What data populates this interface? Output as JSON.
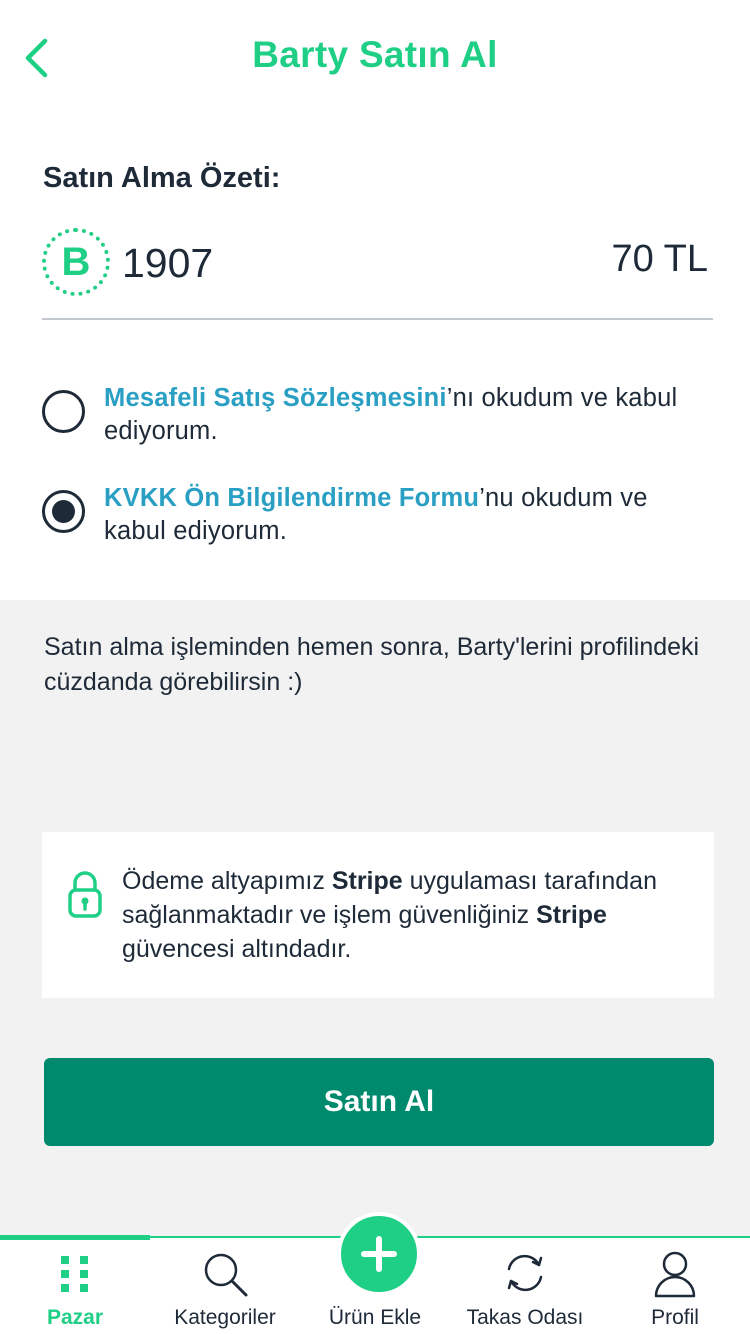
{
  "header": {
    "title": "Barty Satın Al",
    "back_icon": "chevron-left-icon"
  },
  "summary": {
    "title": "Satın Alma Özeti:",
    "coin_letter": "B",
    "amount": "1907",
    "price": "70 TL"
  },
  "agreements": [
    {
      "link": "Mesafeli Satış Sözleşmesini",
      "suffix": "’nı okudum ve kabul ediyorum.",
      "checked": false
    },
    {
      "link": "KVKK Ön Bilgilendirme Formu",
      "suffix": "’nu okudum ve kabul ediyorum.",
      "checked": true
    }
  ],
  "info": {
    "text": "Satın alma işleminden hemen sonra, Barty'lerini profilindeki cüzdanda görebilirsin :)"
  },
  "security": {
    "part1": "Ödeme altyapımız ",
    "brand1": "Stripe",
    "part2": " uygulaması tarafından sağlanmaktadır ve işlem güvenliğiniz ",
    "brand2": "Stripe",
    "part3": " güvencesi altındadır.",
    "icon": "lock-icon"
  },
  "buy_button": {
    "label": "Satın Al"
  },
  "tabbar": {
    "items": [
      {
        "label": "Pazar",
        "icon": "grid-icon",
        "active": true
      },
      {
        "label": "Kategoriler",
        "icon": "search-icon",
        "active": false
      },
      {
        "label": "Ürün Ekle",
        "icon": "plus-icon",
        "active": false
      },
      {
        "label": "Takas Odası",
        "icon": "swap-icon",
        "active": false
      },
      {
        "label": "Profil",
        "icon": "user-icon",
        "active": false
      }
    ]
  },
  "colors": {
    "brand_green": "#1fcf86",
    "button_green": "#008a6d",
    "link_blue": "#2a9fc4",
    "text_dark": "#1e2a38"
  }
}
